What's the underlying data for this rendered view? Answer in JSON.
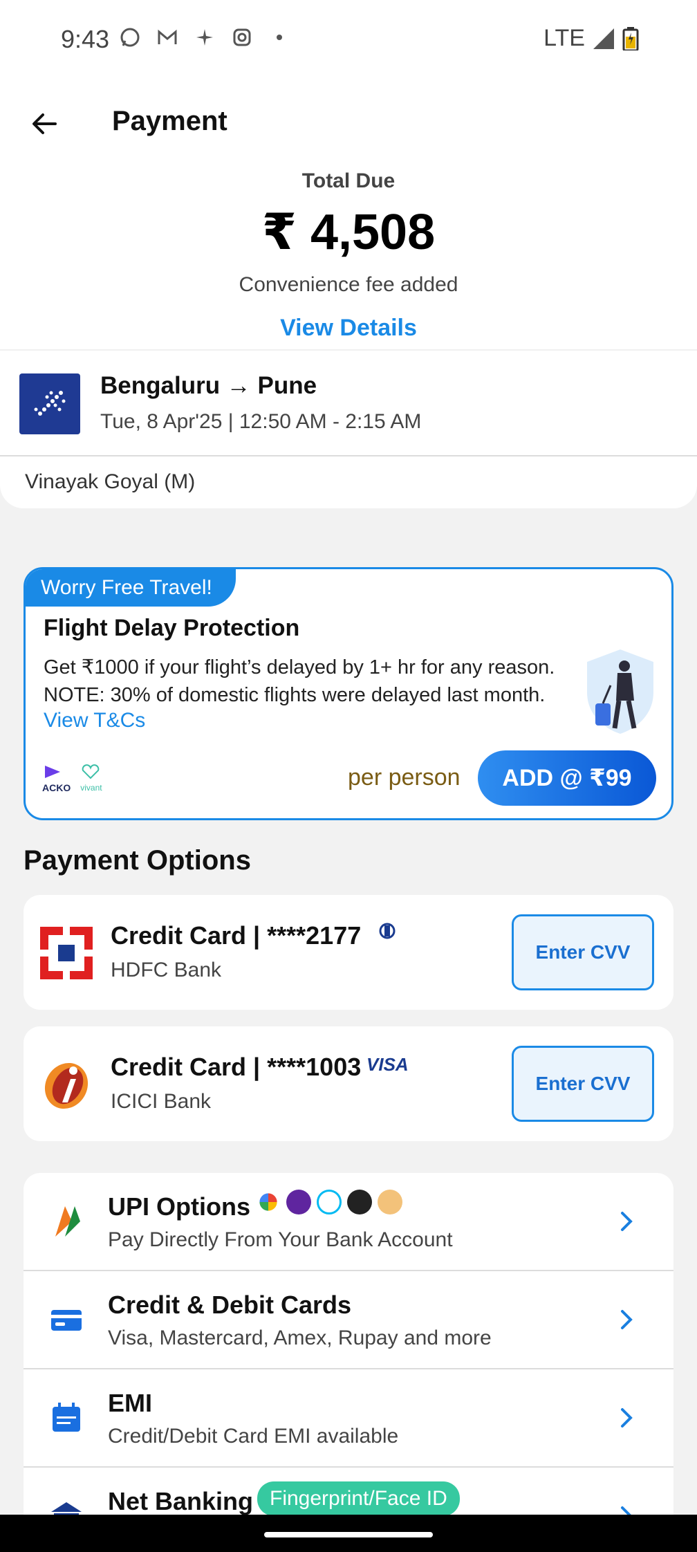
{
  "status_bar": {
    "time": "9:43",
    "network": "LTE"
  },
  "header": {
    "title": "Payment"
  },
  "summary": {
    "total_label": "Total Due",
    "total_amount": "₹ 4,508",
    "fee_note": "Convenience fee added",
    "view_details": "View Details"
  },
  "flight": {
    "route": "Bengaluru → Pune",
    "datetime": "Tue, 8 Apr'25 | 12:50 AM - 2:15 AM",
    "passenger": "Vinayak Goyal (M)"
  },
  "insurance": {
    "badge": "Worry Free Travel!",
    "title": "Flight Delay Protection",
    "desc_line1": "Get ₹1000 if your flight’s delayed by 1+ hr for any reason.",
    "desc_line2": "NOTE: 30% of domestic flights were delayed last month.",
    "link": "View T&Cs",
    "partner1": "ACKO",
    "partner2": "vivant",
    "per_person": "per person",
    "add_label": "ADD @ ₹99"
  },
  "payment": {
    "section_title": "Payment Options",
    "saved_cards": [
      {
        "title": "Credit Card | ****2177",
        "bank": "HDFC Bank",
        "network": "Diners Club",
        "cvv_label": "Enter CVV"
      },
      {
        "title": "Credit Card | ****1003",
        "bank": "ICICI Bank",
        "network": "VISA",
        "cvv_label": "Enter CVV"
      }
    ],
    "options": [
      {
        "title": "UPI Options",
        "subtitle": "Pay Directly From Your Bank Account"
      },
      {
        "title": "Credit & Debit Cards",
        "subtitle": "Visa, Mastercard, Amex, Rupay and more"
      },
      {
        "title": "EMI",
        "subtitle": "Credit/Debit Card EMI available"
      },
      {
        "title": "Net Banking",
        "badge": "Fingerprint/Face ID"
      }
    ]
  },
  "colors": {
    "accent": "#1a8ae6",
    "badge_green": "#36c9a0",
    "indigo": "#1f3a93"
  }
}
